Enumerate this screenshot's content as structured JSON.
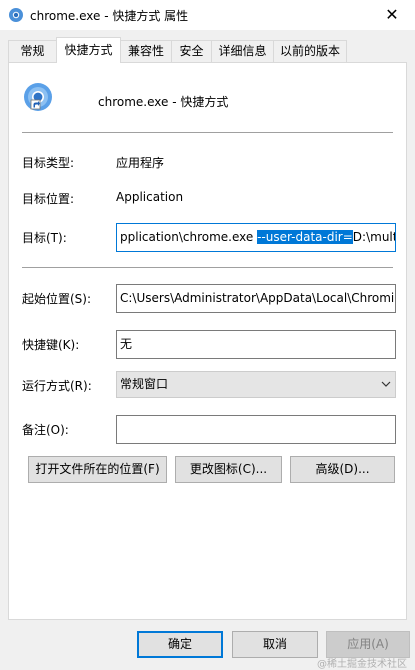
{
  "window": {
    "title": "chrome.exe - 快捷方式 属性",
    "close_glyph": "✕"
  },
  "tabs": [
    {
      "label": "常规",
      "active": false
    },
    {
      "label": "快捷方式",
      "active": true
    },
    {
      "label": "兼容性",
      "active": false
    },
    {
      "label": "安全",
      "active": false
    },
    {
      "label": "详细信息",
      "active": false
    },
    {
      "label": "以前的版本",
      "active": false
    }
  ],
  "shortcut": {
    "name": "chrome.exe - 快捷方式",
    "icon": "chrome-shortcut-icon"
  },
  "fields": {
    "target_type_label": "目标类型:",
    "target_type_value": "应用程序",
    "target_location_label": "目标位置:",
    "target_location_value": "Application",
    "target_label": "目标(T):",
    "target_value_before": "pplication\\chrome.exe ",
    "target_value_selected": "--user-data-dir=",
    "target_value_after": "D:\\multip",
    "start_in_label": "起始位置(S):",
    "start_in_value": "C:\\Users\\Administrator\\AppData\\Local\\Chromiu",
    "shortcut_key_label": "快捷键(K):",
    "shortcut_key_value": "无",
    "run_label": "运行方式(R):",
    "run_value": "常规窗口",
    "comment_label": "备注(O):",
    "comment_value": ""
  },
  "actions": {
    "open_location": "打开文件所在的位置(F)",
    "change_icon": "更改图标(C)...",
    "advanced": "高级(D)..."
  },
  "footer": {
    "ok": "确定",
    "cancel": "取消",
    "apply": "应用(A)"
  },
  "watermark": "@稀土掘金技术社区",
  "colors": {
    "accent": "#0078d7",
    "window_bg": "#f0f0f0",
    "panel_bg": "#ffffff"
  }
}
